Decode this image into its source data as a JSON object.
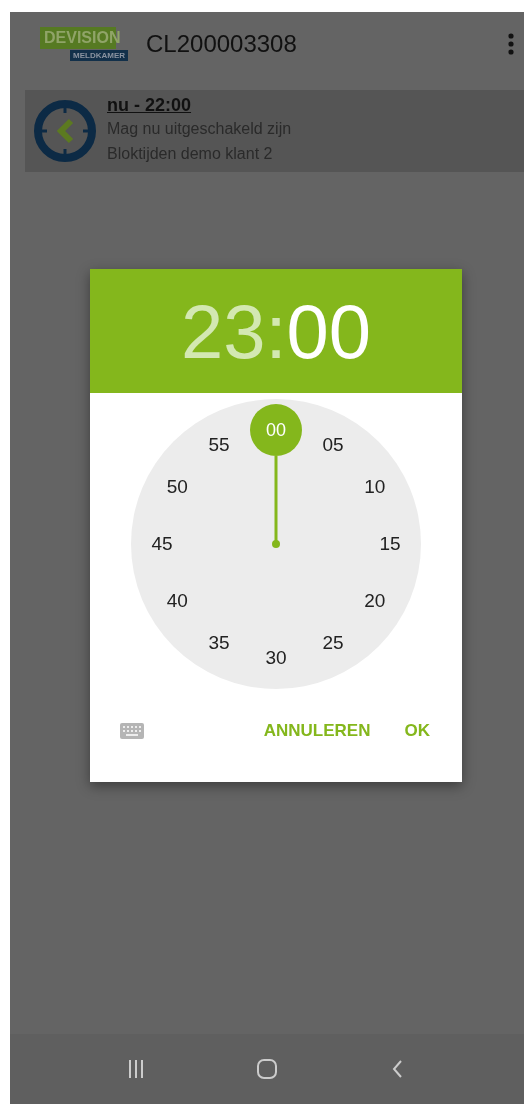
{
  "app_bar": {
    "logo_top": "DEVISION",
    "logo_bottom": "MELDKAMER",
    "title": "CL200003308"
  },
  "schedule_item": {
    "time": "nu - 22:00",
    "status": "Mag nu uitgeschakeld zijn",
    "name": "Bloktijden demo klant 2"
  },
  "time_picker": {
    "hour": {
      "text": "23",
      "selected": false
    },
    "separator": ":",
    "minute": {
      "text": "00",
      "selected": true
    },
    "dial": [
      {
        "label": "00",
        "selected": true
      },
      {
        "label": "05",
        "selected": false
      },
      {
        "label": "10",
        "selected": false
      },
      {
        "label": "15",
        "selected": false
      },
      {
        "label": "20",
        "selected": false
      },
      {
        "label": "25",
        "selected": false
      },
      {
        "label": "30",
        "selected": false
      },
      {
        "label": "35",
        "selected": false
      },
      {
        "label": "40",
        "selected": false
      },
      {
        "label": "45",
        "selected": false
      },
      {
        "label": "50",
        "selected": false
      },
      {
        "label": "55",
        "selected": false
      }
    ],
    "buttons": [
      "ANNULEREN",
      "OK"
    ]
  }
}
